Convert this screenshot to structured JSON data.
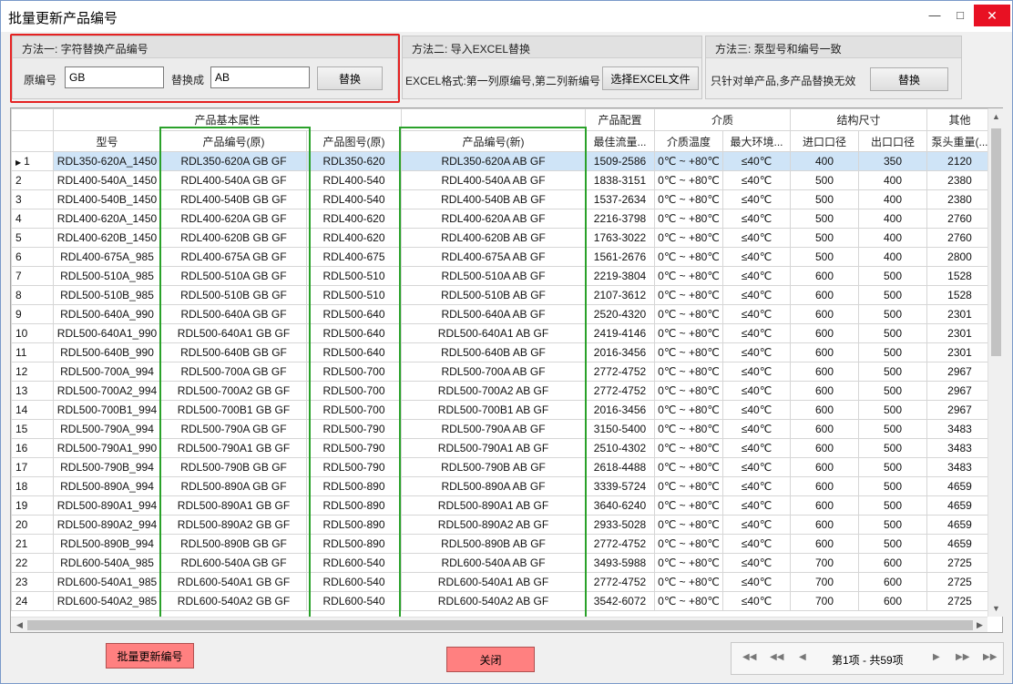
{
  "window": {
    "title": "批量更新产品编号"
  },
  "method1": {
    "title": "方法一: 字符替换产品编号",
    "source_label": "原编号",
    "source_value": "GB",
    "target_label": "替换成",
    "target_value": "AB",
    "replace_label": "替换"
  },
  "method2": {
    "title": "方法二: 导入EXCEL替换",
    "hint": "EXCEL格式:第一列原编号,第二列新编号",
    "choose_label": "选择EXCEL文件"
  },
  "method3": {
    "title": "方法三: 泵型号和编号一致",
    "hint": "只针对单产品,多产品替换无效",
    "replace_label": "替换"
  },
  "table": {
    "groups": {
      "basic": "产品基本属性",
      "config": "产品配置",
      "medium": "介质",
      "size": "结构尺寸",
      "other": "其他"
    },
    "columns": {
      "model": "型号",
      "code_old": "产品编号(原)",
      "drawing_old": "产品图号(原)",
      "code_new": "产品编号(新)",
      "flow": "最佳流量...",
      "temp": "介质温度",
      "env": "最大环境...",
      "inlet": "进口口径",
      "outlet": "出口口径",
      "weight": "泵头重量(..."
    },
    "rows": [
      [
        "1",
        "RDL350-620A_1450",
        "RDL350-620A GB GF",
        "RDL350-620",
        "RDL350-620A AB GF",
        "1509-2586",
        "0℃ ~ +80℃",
        "≤40℃",
        "400",
        "350",
        "2120"
      ],
      [
        "2",
        "RDL400-540A_1450",
        "RDL400-540A GB GF",
        "RDL400-540",
        "RDL400-540A AB GF",
        "1838-3151",
        "0℃ ~ +80℃",
        "≤40℃",
        "500",
        "400",
        "2380"
      ],
      [
        "3",
        "RDL400-540B_1450",
        "RDL400-540B GB GF",
        "RDL400-540",
        "RDL400-540B AB GF",
        "1537-2634",
        "0℃ ~ +80℃",
        "≤40℃",
        "500",
        "400",
        "2380"
      ],
      [
        "4",
        "RDL400-620A_1450",
        "RDL400-620A GB GF",
        "RDL400-620",
        "RDL400-620A AB GF",
        "2216-3798",
        "0℃ ~ +80℃",
        "≤40℃",
        "500",
        "400",
        "2760"
      ],
      [
        "5",
        "RDL400-620B_1450",
        "RDL400-620B GB GF",
        "RDL400-620",
        "RDL400-620B AB GF",
        "1763-3022",
        "0℃ ~ +80℃",
        "≤40℃",
        "500",
        "400",
        "2760"
      ],
      [
        "6",
        "RDL400-675A_985",
        "RDL400-675A GB GF",
        "RDL400-675",
        "RDL400-675A AB GF",
        "1561-2676",
        "0℃ ~ +80℃",
        "≤40℃",
        "500",
        "400",
        "2800"
      ],
      [
        "7",
        "RDL500-510A_985",
        "RDL500-510A GB GF",
        "RDL500-510",
        "RDL500-510A AB GF",
        "2219-3804",
        "0℃ ~ +80℃",
        "≤40℃",
        "600",
        "500",
        "1528"
      ],
      [
        "8",
        "RDL500-510B_985",
        "RDL500-510B GB GF",
        "RDL500-510",
        "RDL500-510B AB GF",
        "2107-3612",
        "0℃ ~ +80℃",
        "≤40℃",
        "600",
        "500",
        "1528"
      ],
      [
        "9",
        "RDL500-640A_990",
        "RDL500-640A GB GF",
        "RDL500-640",
        "RDL500-640A AB GF",
        "2520-4320",
        "0℃ ~ +80℃",
        "≤40℃",
        "600",
        "500",
        "2301"
      ],
      [
        "10",
        "RDL500-640A1_990",
        "RDL500-640A1 GB GF",
        "RDL500-640",
        "RDL500-640A1 AB GF",
        "2419-4146",
        "0℃ ~ +80℃",
        "≤40℃",
        "600",
        "500",
        "2301"
      ],
      [
        "11",
        "RDL500-640B_990",
        "RDL500-640B GB GF",
        "RDL500-640",
        "RDL500-640B AB GF",
        "2016-3456",
        "0℃ ~ +80℃",
        "≤40℃",
        "600",
        "500",
        "2301"
      ],
      [
        "12",
        "RDL500-700A_994",
        "RDL500-700A GB GF",
        "RDL500-700",
        "RDL500-700A AB GF",
        "2772-4752",
        "0℃ ~ +80℃",
        "≤40℃",
        "600",
        "500",
        "2967"
      ],
      [
        "13",
        "RDL500-700A2_994",
        "RDL500-700A2 GB GF",
        "RDL500-700",
        "RDL500-700A2 AB GF",
        "2772-4752",
        "0℃ ~ +80℃",
        "≤40℃",
        "600",
        "500",
        "2967"
      ],
      [
        "14",
        "RDL500-700B1_994",
        "RDL500-700B1 GB GF",
        "RDL500-700",
        "RDL500-700B1 AB GF",
        "2016-3456",
        "0℃ ~ +80℃",
        "≤40℃",
        "600",
        "500",
        "2967"
      ],
      [
        "15",
        "RDL500-790A_994",
        "RDL500-790A GB GF",
        "RDL500-790",
        "RDL500-790A AB GF",
        "3150-5400",
        "0℃ ~ +80℃",
        "≤40℃",
        "600",
        "500",
        "3483"
      ],
      [
        "16",
        "RDL500-790A1_990",
        "RDL500-790A1 GB GF",
        "RDL500-790",
        "RDL500-790A1 AB GF",
        "2510-4302",
        "0℃ ~ +80℃",
        "≤40℃",
        "600",
        "500",
        "3483"
      ],
      [
        "17",
        "RDL500-790B_994",
        "RDL500-790B GB GF",
        "RDL500-790",
        "RDL500-790B AB GF",
        "2618-4488",
        "0℃ ~ +80℃",
        "≤40℃",
        "600",
        "500",
        "3483"
      ],
      [
        "18",
        "RDL500-890A_994",
        "RDL500-890A GB GF",
        "RDL500-890",
        "RDL500-890A AB GF",
        "3339-5724",
        "0℃ ~ +80℃",
        "≤40℃",
        "600",
        "500",
        "4659"
      ],
      [
        "19",
        "RDL500-890A1_994",
        "RDL500-890A1 GB GF",
        "RDL500-890",
        "RDL500-890A1 AB GF",
        "3640-6240",
        "0℃ ~ +80℃",
        "≤40℃",
        "600",
        "500",
        "4659"
      ],
      [
        "20",
        "RDL500-890A2_994",
        "RDL500-890A2 GB GF",
        "RDL500-890",
        "RDL500-890A2 AB GF",
        "2933-5028",
        "0℃ ~ +80℃",
        "≤40℃",
        "600",
        "500",
        "4659"
      ],
      [
        "21",
        "RDL500-890B_994",
        "RDL500-890B GB GF",
        "RDL500-890",
        "RDL500-890B AB GF",
        "2772-4752",
        "0℃ ~ +80℃",
        "≤40℃",
        "600",
        "500",
        "4659"
      ],
      [
        "22",
        "RDL600-540A_985",
        "RDL600-540A GB GF",
        "RDL600-540",
        "RDL600-540A AB GF",
        "3493-5988",
        "0℃ ~ +80℃",
        "≤40℃",
        "700",
        "600",
        "2725"
      ],
      [
        "23",
        "RDL600-540A1_985",
        "RDL600-540A1 GB GF",
        "RDL600-540",
        "RDL600-540A1 AB GF",
        "2772-4752",
        "0℃ ~ +80℃",
        "≤40℃",
        "700",
        "600",
        "2725"
      ],
      [
        "24",
        "RDL600-540A2_985",
        "RDL600-540A2 GB GF",
        "RDL600-540",
        "RDL600-540A2 AB GF",
        "3542-6072",
        "0℃ ~ +80℃",
        "≤40℃",
        "700",
        "600",
        "2725"
      ]
    ],
    "selected_row": 0
  },
  "footer": {
    "batch_update_label": "批量更新编号",
    "close_label": "关闭",
    "pager_text": "第1项 - 共59项"
  },
  "colors": {
    "highlight_red": "#e52222",
    "highlight_green": "#2aa12a",
    "action_button": "#ff8080",
    "selected_row": "#cfe4f7"
  },
  "icons": {
    "minimize": "minimize-icon",
    "maximize": "maximize-icon",
    "close": "close-icon",
    "row_pointer": "row-pointer-icon"
  }
}
